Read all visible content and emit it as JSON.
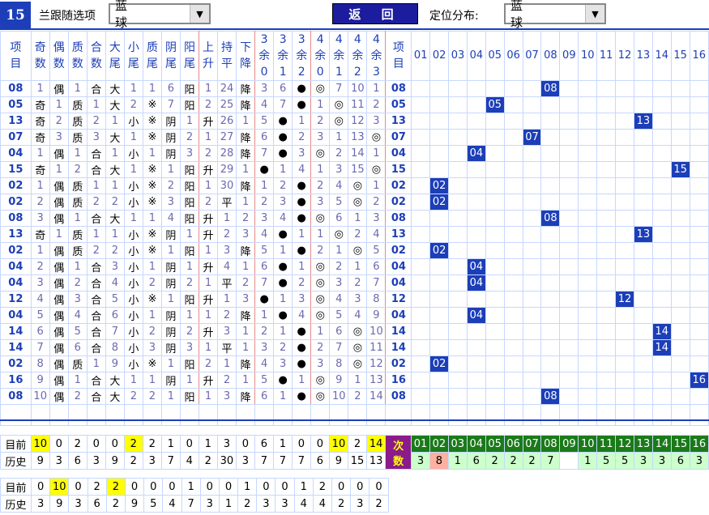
{
  "top": {
    "num": "15",
    "label1": "兰跟随选项",
    "sel1": "蓝 球",
    "back": "返 回",
    "label2": "定位分布:",
    "sel2": "蓝 球"
  },
  "headers": [
    "项目",
    "奇数",
    "偶数",
    "质数",
    "合数",
    "大尾",
    "小尾",
    "质尾",
    "阴尾",
    "阳尾",
    "上升",
    "持平",
    "下降",
    "3余0",
    "3余1",
    "3余2",
    "4余0",
    "4余1",
    "4余2",
    "4余3",
    "项目"
  ],
  "nums": [
    "01",
    "02",
    "03",
    "04",
    "05",
    "06",
    "07",
    "08",
    "09",
    "10",
    "11",
    "12",
    "13",
    "14",
    "15",
    "16"
  ],
  "rows": [
    [
      "08",
      "1",
      "偶",
      "1",
      "合",
      "大",
      "1",
      "1",
      "6",
      "阳",
      "1",
      "24",
      "降",
      "3",
      "6",
      "●",
      "◎",
      "7",
      "10",
      "1",
      "08"
    ],
    [
      "05",
      "奇",
      "1",
      "质",
      "1",
      "大",
      "2",
      "※",
      "7",
      "阳",
      "2",
      "25",
      "降",
      "4",
      "7",
      "●",
      "1",
      "◎",
      "11",
      "2",
      "05"
    ],
    [
      "13",
      "奇",
      "2",
      "质",
      "2",
      "1",
      "小",
      "※",
      "阴",
      "1",
      "升",
      "26",
      "1",
      "5",
      "●",
      "1",
      "2",
      "◎",
      "12",
      "3",
      "13"
    ],
    [
      "07",
      "奇",
      "3",
      "质",
      "3",
      "大",
      "1",
      "※",
      "阴",
      "2",
      "1",
      "27",
      "降",
      "6",
      "●",
      "2",
      "3",
      "1",
      "13",
      "◎",
      "07"
    ],
    [
      "04",
      "1",
      "偶",
      "1",
      "合",
      "1",
      "小",
      "1",
      "阴",
      "3",
      "2",
      "28",
      "降",
      "7",
      "●",
      "3",
      "◎",
      "2",
      "14",
      "1",
      "04"
    ],
    [
      "15",
      "奇",
      "1",
      "2",
      "合",
      "大",
      "1",
      "※",
      "1",
      "阳",
      "升",
      "29",
      "1",
      "●",
      "1",
      "4",
      "1",
      "3",
      "15",
      "◎",
      "15"
    ],
    [
      "02",
      "1",
      "偶",
      "质",
      "1",
      "1",
      "小",
      "※",
      "2",
      "阳",
      "1",
      "30",
      "降",
      "1",
      "2",
      "●",
      "2",
      "4",
      "◎",
      "1",
      "02"
    ],
    [
      "02",
      "2",
      "偶",
      "质",
      "2",
      "2",
      "小",
      "※",
      "3",
      "阳",
      "2",
      "平",
      "1",
      "2",
      "3",
      "●",
      "3",
      "5",
      "◎",
      "2",
      "02"
    ],
    [
      "08",
      "3",
      "偶",
      "1",
      "合",
      "大",
      "1",
      "1",
      "4",
      "阳",
      "升",
      "1",
      "2",
      "3",
      "4",
      "●",
      "◎",
      "6",
      "1",
      "3",
      "08"
    ],
    [
      "13",
      "奇",
      "1",
      "质",
      "1",
      "1",
      "小",
      "※",
      "阴",
      "1",
      "升",
      "2",
      "3",
      "4",
      "●",
      "1",
      "1",
      "◎",
      "2",
      "4",
      "13"
    ],
    [
      "02",
      "1",
      "偶",
      "质",
      "2",
      "2",
      "小",
      "※",
      "1",
      "阳",
      "1",
      "1",
      "3",
      "降",
      "5",
      "1",
      "●",
      "2",
      "1",
      "◎",
      "5",
      "02"
    ],
    [
      "04",
      "2",
      "偶",
      "1",
      "合",
      "3",
      "小",
      "1",
      "阴",
      "1",
      "升",
      "4",
      "1",
      "6",
      "●",
      "1",
      "◎",
      "2",
      "1",
      "6",
      "04"
    ],
    [
      "04",
      "3",
      "偶",
      "2",
      "合",
      "4",
      "小",
      "2",
      "阴",
      "2",
      "1",
      "平",
      "2",
      "7",
      "●",
      "2",
      "◎",
      "3",
      "2",
      "7",
      "04"
    ],
    [
      "12",
      "4",
      "偶",
      "3",
      "合",
      "5",
      "小",
      "※",
      "1",
      "阳",
      "升",
      "1",
      "3",
      "●",
      "1",
      "3",
      "◎",
      "4",
      "3",
      "8",
      "12"
    ],
    [
      "04",
      "5",
      "偶",
      "4",
      "合",
      "6",
      "小",
      "1",
      "阴",
      "1",
      "1",
      "2",
      "降",
      "1",
      "●",
      "4",
      "◎",
      "5",
      "4",
      "9",
      "04"
    ],
    [
      "14",
      "6",
      "偶",
      "5",
      "合",
      "7",
      "小",
      "2",
      "阴",
      "2",
      "升",
      "3",
      "1",
      "2",
      "1",
      "●",
      "1",
      "6",
      "◎",
      "10",
      "14"
    ],
    [
      "14",
      "7",
      "偶",
      "6",
      "合",
      "8",
      "小",
      "3",
      "阴",
      "3",
      "1",
      "平",
      "1",
      "3",
      "2",
      "●",
      "2",
      "7",
      "◎",
      "11",
      "14"
    ],
    [
      "02",
      "8",
      "偶",
      "质",
      "1",
      "9",
      "小",
      "※",
      "1",
      "阳",
      "2",
      "1",
      "降",
      "4",
      "3",
      "●",
      "3",
      "8",
      "◎",
      "12",
      "02"
    ],
    [
      "16",
      "9",
      "偶",
      "1",
      "合",
      "大",
      "1",
      "1",
      "阴",
      "1",
      "升",
      "2",
      "1",
      "5",
      "●",
      "1",
      "◎",
      "9",
      "1",
      "13",
      "16"
    ],
    [
      "08",
      "10",
      "偶",
      "2",
      "合",
      "大",
      "2",
      "2",
      "1",
      "阳",
      "1",
      "3",
      "降",
      "6",
      "1",
      "●",
      "◎",
      "10",
      "2",
      "14",
      "08"
    ]
  ],
  "row_cells": [
    [
      "1",
      "偶",
      "1",
      "合",
      "大",
      "1",
      "1",
      "6",
      "阳",
      "1",
      "24",
      "降",
      "3",
      "6",
      "●",
      "◎",
      "7",
      "10",
      "1"
    ],
    [
      "奇",
      "1",
      "质",
      "1",
      "大",
      "2",
      "※",
      "7",
      "阳",
      "2",
      "25",
      "降",
      "4",
      "7",
      "●",
      "1",
      "◎",
      "11",
      "2"
    ],
    [
      "奇",
      "2",
      "质",
      "2",
      "1",
      "小",
      "※",
      "阴",
      "1",
      "升",
      "26",
      "1",
      "5",
      "●",
      "1",
      "2",
      "◎",
      "12",
      "3"
    ],
    [
      "奇",
      "3",
      "质",
      "3",
      "大",
      "1",
      "※",
      "阴",
      "2",
      "1",
      "27",
      "降",
      "6",
      "●",
      "2",
      "3",
      "1",
      "13",
      "◎"
    ],
    [
      "1",
      "偶",
      "1",
      "合",
      "1",
      "小",
      "1",
      "阴",
      "3",
      "2",
      "28",
      "降",
      "7",
      "●",
      "3",
      "◎",
      "2",
      "14",
      "1"
    ],
    [
      "奇",
      "1",
      "2",
      "合",
      "大",
      "1",
      "※",
      "1",
      "阳",
      "升",
      "29",
      "1",
      "●",
      "1",
      "4",
      "1",
      "3",
      "15",
      "◎"
    ],
    [
      "1",
      "偶",
      "质",
      "1",
      "1",
      "小",
      "※",
      "2",
      "阳",
      "1",
      "30",
      "降",
      "1",
      "2",
      "●",
      "2",
      "4",
      "◎",
      "1"
    ],
    [
      "2",
      "偶",
      "质",
      "2",
      "2",
      "小",
      "※",
      "3",
      "阳",
      "2",
      "平",
      "1",
      "2",
      "3",
      "●",
      "3",
      "5",
      "◎",
      "2"
    ],
    [
      "3",
      "偶",
      "1",
      "合",
      "大",
      "1",
      "1",
      "4",
      "阳",
      "升",
      "1",
      "2",
      "3",
      "4",
      "●",
      "◎",
      "6",
      "1",
      "3"
    ],
    [
      "奇",
      "1",
      "质",
      "1",
      "1",
      "小",
      "※",
      "阴",
      "1",
      "升",
      "2",
      "3",
      "4",
      "●",
      "1",
      "1",
      "◎",
      "2",
      "4"
    ],
    [
      "1",
      "偶",
      "质",
      "2",
      "2",
      "小",
      "※",
      "1",
      "阳",
      "1",
      "3",
      "降",
      "5",
      "1",
      "●",
      "2",
      "1",
      "◎",
      "5"
    ],
    [
      "2",
      "偶",
      "1",
      "合",
      "3",
      "小",
      "1",
      "阴",
      "1",
      "升",
      "4",
      "1",
      "6",
      "●",
      "1",
      "◎",
      "2",
      "1",
      "6"
    ],
    [
      "3",
      "偶",
      "2",
      "合",
      "4",
      "小",
      "2",
      "阴",
      "2",
      "1",
      "平",
      "2",
      "7",
      "●",
      "2",
      "◎",
      "3",
      "2",
      "7"
    ],
    [
      "4",
      "偶",
      "3",
      "合",
      "5",
      "小",
      "※",
      "1",
      "阳",
      "升",
      "1",
      "3",
      "●",
      "1",
      "3",
      "◎",
      "4",
      "3",
      "8"
    ],
    [
      "5",
      "偶",
      "4",
      "合",
      "6",
      "小",
      "1",
      "阴",
      "1",
      "1",
      "2",
      "降",
      "1",
      "●",
      "4",
      "◎",
      "5",
      "4",
      "9"
    ],
    [
      "6",
      "偶",
      "5",
      "合",
      "7",
      "小",
      "2",
      "阴",
      "2",
      "升",
      "3",
      "1",
      "2",
      "1",
      "●",
      "1",
      "6",
      "◎",
      "10"
    ],
    [
      "7",
      "偶",
      "6",
      "合",
      "8",
      "小",
      "3",
      "阴",
      "3",
      "1",
      "平",
      "1",
      "3",
      "2",
      "●",
      "2",
      "7",
      "◎",
      "11"
    ],
    [
      "8",
      "偶",
      "质",
      "1",
      "9",
      "小",
      "※",
      "1",
      "阳",
      "2",
      "1",
      "降",
      "4",
      "3",
      "●",
      "3",
      "8",
      "◎",
      "12"
    ],
    [
      "9",
      "偶",
      "1",
      "合",
      "大",
      "1",
      "1",
      "阴",
      "1",
      "升",
      "2",
      "1",
      "5",
      "●",
      "1",
      "◎",
      "9",
      "1",
      "13"
    ],
    [
      "10",
      "偶",
      "2",
      "合",
      "大",
      "2",
      "2",
      "1",
      "阳",
      "1",
      "3",
      "降",
      "6",
      "1",
      "●",
      "◎",
      "10",
      "2",
      "14"
    ]
  ],
  "row_ids": [
    "08",
    "05",
    "13",
    "07",
    "04",
    "15",
    "02",
    "02",
    "08",
    "13",
    "02",
    "04",
    "04",
    "12",
    "04",
    "14",
    "14",
    "02",
    "16",
    "08"
  ],
  "stats1": {
    "cur_label": "目前",
    "hist_label": "历史",
    "cur": [
      "10",
      "0",
      "2",
      "0",
      "0",
      "2",
      "2",
      "1",
      "0",
      "1",
      "3",
      "0",
      "6",
      "1",
      "0",
      "0",
      "10",
      "2",
      "14"
    ],
    "hist": [
      "9",
      "3",
      "6",
      "3",
      "9",
      "2",
      "3",
      "7",
      "4",
      "2",
      "30",
      "3",
      "7",
      "7",
      "7",
      "6",
      "9",
      "15",
      "13"
    ]
  },
  "cishu": {
    "label": "次数",
    "nums": [
      "01",
      "02",
      "03",
      "04",
      "05",
      "06",
      "07",
      "08",
      "09",
      "10",
      "11",
      "12",
      "13",
      "14",
      "15",
      "16"
    ],
    "vals": [
      "3",
      "8",
      "1",
      "6",
      "2",
      "2",
      "2",
      "7",
      "",
      "1",
      "5",
      "5",
      "3",
      "3",
      "6",
      "3"
    ]
  },
  "stats2": {
    "cur_label": "目前",
    "hist_label": "历史",
    "cur": [
      "0",
      "10",
      "0",
      "2",
      "2",
      "0",
      "0",
      "0",
      "1",
      "0",
      "0",
      "1",
      "0",
      "0",
      "1",
      "2",
      "0",
      "0",
      "0"
    ],
    "hist": [
      "3",
      "9",
      "3",
      "6",
      "2",
      "9",
      "5",
      "4",
      "7",
      "3",
      "1",
      "2",
      "3",
      "3",
      "4",
      "4",
      "2",
      "3",
      "2"
    ]
  },
  "colors": {
    "accent": "#1c3eb8",
    "highlight": "#ffff00",
    "cishu": "#8b1a8b",
    "green": "#1a7a1a"
  }
}
